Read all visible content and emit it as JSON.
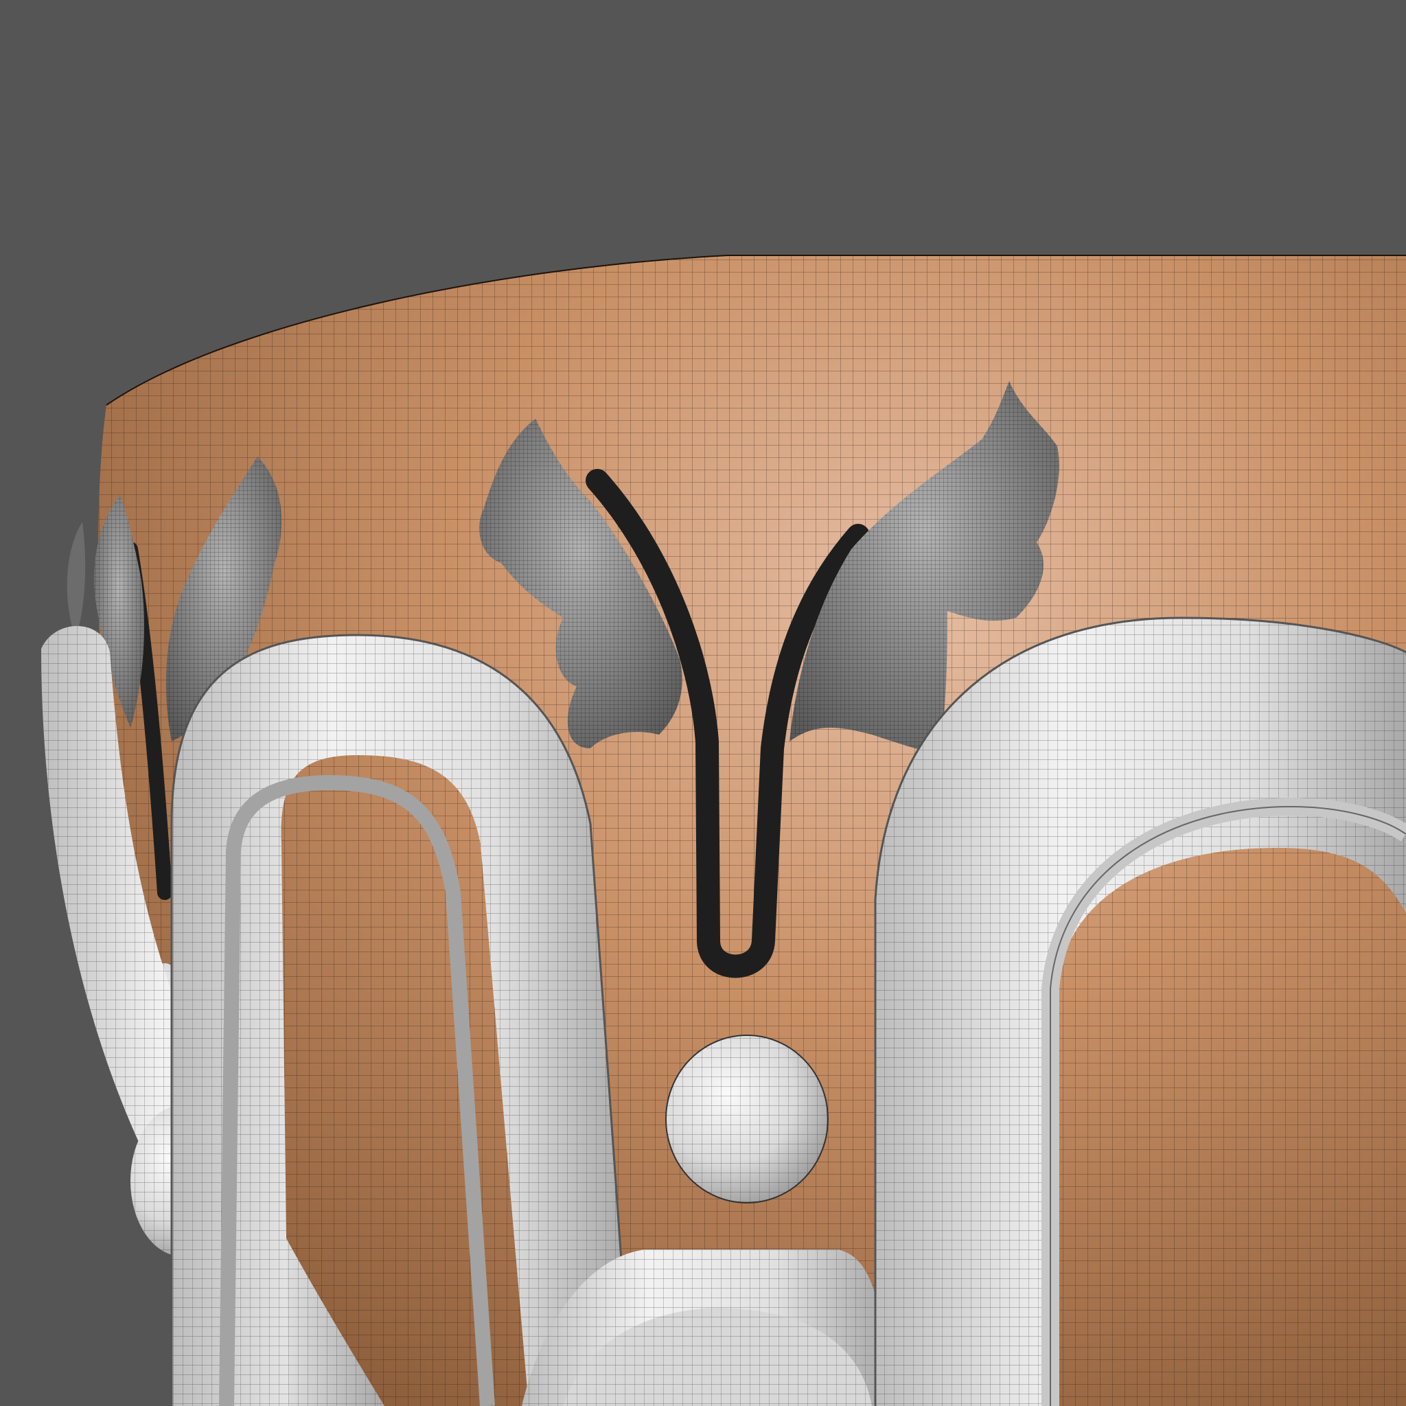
{
  "viewport": {
    "background_color": "#555555",
    "shading": "wireframe-on-shaded"
  },
  "vase": {
    "body_color": "#c38a5f",
    "body_highlight_color": "#dfb396",
    "body_shadow_color": "#94643f",
    "wire_color": "#2a1a10"
  },
  "ornaments": {
    "leaf_color": "#8a8a8a",
    "leaf_stem_color": "#222222",
    "arch_color": "#e4e4e4",
    "arch_shadow_color": "#a8a8a8",
    "sphere_color": "#dcdcdc"
  }
}
